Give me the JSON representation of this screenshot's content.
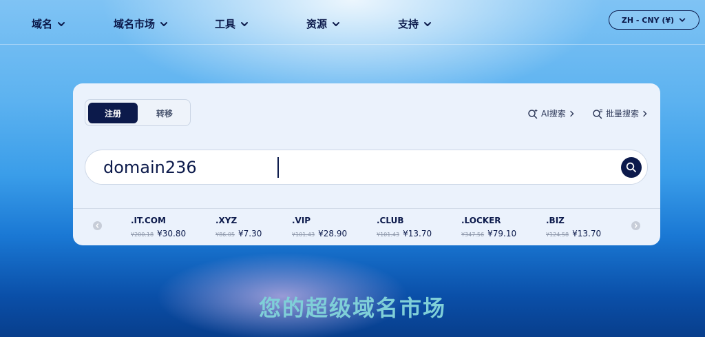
{
  "nav": {
    "items": [
      {
        "label": "域名"
      },
      {
        "label": "域名市场"
      },
      {
        "label": "工具"
      },
      {
        "label": "资源"
      },
      {
        "label": "支持"
      }
    ],
    "lang_label": "ZH - CNY (¥)"
  },
  "search_card": {
    "tabs": {
      "register": "注册",
      "transfer": "转移"
    },
    "ai_search": "AI搜索",
    "bulk_search": "批量搜索",
    "query": "domain236"
  },
  "tlds": [
    {
      "name": ".IT.COM",
      "old_price": "¥200.18",
      "price": "¥30.80"
    },
    {
      "name": ".XYZ",
      "old_price": "¥86.05",
      "price": "¥7.30"
    },
    {
      "name": ".VIP",
      "old_price": "¥101.43",
      "price": "¥28.90"
    },
    {
      "name": ".CLUB",
      "old_price": "¥101.43",
      "price": "¥13.70"
    },
    {
      "name": ".LOCKER",
      "old_price": "¥347.56",
      "price": "¥79.10"
    },
    {
      "name": ".BIZ",
      "old_price": "¥124.58",
      "price": "¥13.70"
    }
  ],
  "hero": {
    "slogan": "您的超级域名市场"
  },
  "colors": {
    "brand_navy": "#0c1a4b",
    "slogan": "#7fcfd8"
  }
}
